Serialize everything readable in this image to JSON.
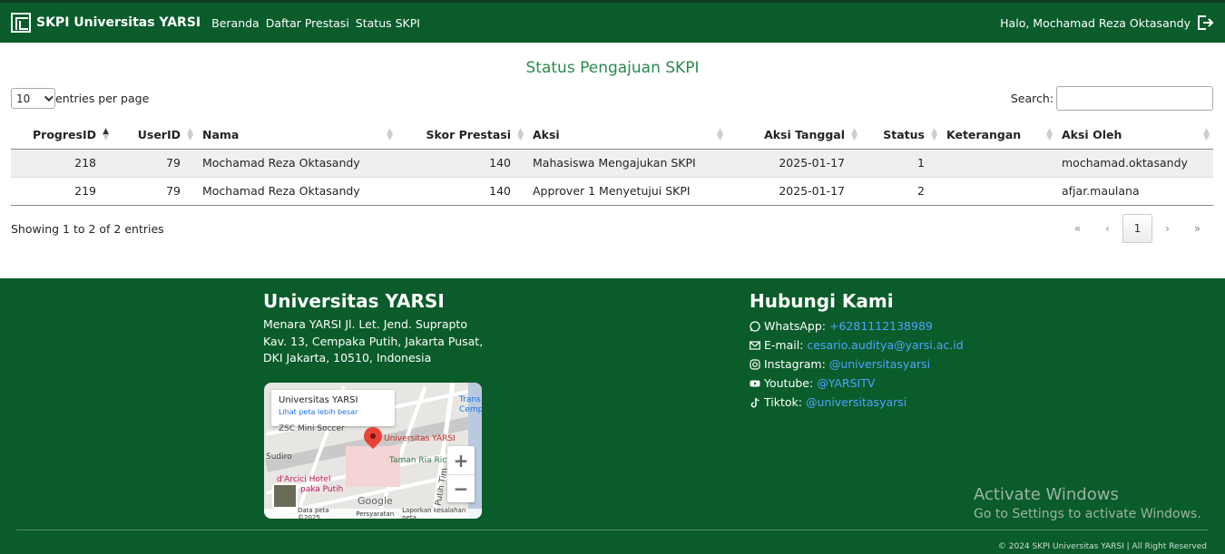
{
  "navbar": {
    "brand": "SKPI Universitas YARSI",
    "links": [
      "Beranda",
      "Daftar Prestasi",
      "Status SKPI"
    ],
    "greeting": "Halo, Mochamad Reza Oktasandy",
    "bg_color": "#0a5c2a"
  },
  "main": {
    "title": "Status Pengajuan SKPI",
    "length_value": "10",
    "length_suffix": "entries per page",
    "search_label": "Search:",
    "search_value": "",
    "columns": [
      "ProgresID",
      "UserID",
      "Nama",
      "Skor Prestasi",
      "Aksi",
      "Aksi Tanggal",
      "Status",
      "Keterangan",
      "Aksi Oleh"
    ],
    "rows": [
      [
        "218",
        "79",
        "Mochamad Reza Oktasandy",
        "140",
        "Mahasiswa Mengajukan SKPI",
        "2025-01-17",
        "1",
        "",
        "mochamad.oktasandy"
      ],
      [
        "219",
        "79",
        "Mochamad Reza Oktasandy",
        "140",
        "Approver 1 Menyetujui SKPI",
        "2025-01-17",
        "2",
        "",
        "afjar.maulana"
      ]
    ],
    "info": "Showing 1 to 2 of 2 entries",
    "pager": {
      "first": "«",
      "prev": "‹",
      "current": "1",
      "next": "›",
      "last": "»"
    }
  },
  "footer": {
    "uni_title": "Universitas YARSI",
    "address": "Menara YARSI Jl. Let. Jend. Suprapto Kav. 13, Cempaka Putih, Jakarta Pusat, DKI Jakarta, 10510, Indonesia",
    "map": {
      "card_title": "Universitas YARSI",
      "card_link": "Lihat peta lebih besar",
      "label_place": "Universitas YARSI",
      "label_soccer": "ZSC Mini Soccer",
      "label_hotel": "d'Arcici Hotel",
      "label_hotel2": "paka Putih",
      "label_taman": "Taman Ria Ric",
      "label_trans": "Trans",
      "label_cemp": "Cemp",
      "label_sudiro": "Sudiro",
      "label_putih": "Putih Tim",
      "zoom_in": "+",
      "zoom_out": "−",
      "google": "Google",
      "bottom": [
        "Data peta ©2025",
        "Persyaratan",
        "Laporkan kesalahan peta"
      ]
    },
    "contact_title": "Hubungi Kami",
    "contacts": [
      {
        "label": "WhatsApp:",
        "value": "+6281112138989",
        "icon": "whatsapp-icon"
      },
      {
        "label": "E-mail:",
        "value": "cesario.auditya@yarsi.ac.id",
        "icon": "mail-icon"
      },
      {
        "label": "Instagram:",
        "value": "@universitasyarsi",
        "icon": "instagram-icon"
      },
      {
        "label": "Youtube:",
        "value": "@YARSITV",
        "icon": "youtube-icon"
      },
      {
        "label": "Tiktok:",
        "value": "@universitasyarsi",
        "icon": "tiktok-icon"
      }
    ],
    "copyright": "© 2024 SKPI Universitas YARSI | All Right Reserved",
    "link_color": "#4ea3ff"
  },
  "overlay": {
    "activate_line1": "Activate Windows",
    "activate_line2": "Go to Settings to activate Windows."
  }
}
